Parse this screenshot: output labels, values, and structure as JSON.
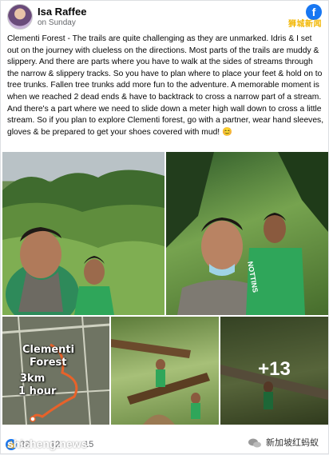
{
  "post": {
    "author": "Isa Raffee",
    "time": "on Sunday",
    "brand_text": "狮城新闻",
    "brand_icon_letter": "f",
    "text": "Clementi Forest - The trails are quite challenging as they are unmarked. Idris & I set out on the journey with clueless on the directions. Most parts of the trails are muddy & slippery. And there are parts where you have to walk at the sides of streams through the narrow & slippery tracks. So you have to plan where to place your feet & hold on to tree trunks. Fallen tree trunks add more fun to the adventure. A memorable moment is when we reached 2 dead ends & have to backtrack to cross a narrow part of a stream. And there's a part where we need to slide down a meter high wall down to cross a little stream. So if you plan to explore Clementi forest, go with a partner, wear hand sleeves, gloves & be prepared to get your shoes covered with mud! 😊"
  },
  "photos": {
    "map_title_1": "Clementi",
    "map_title_2": "Forest",
    "map_distance": "3km",
    "map_duration": "1 hour",
    "more_count": "+13",
    "shirt_text": "NOTTINS"
  },
  "footer": {
    "reactions": "32",
    "comments": "12",
    "shares": "15",
    "watermark_left": "shicheng.news",
    "watermark_right": "新加坡红蚂蚁"
  },
  "colors": {
    "accent": "#1877f2",
    "brand_gold": "#f2b705",
    "map_route": "#e8622a"
  }
}
